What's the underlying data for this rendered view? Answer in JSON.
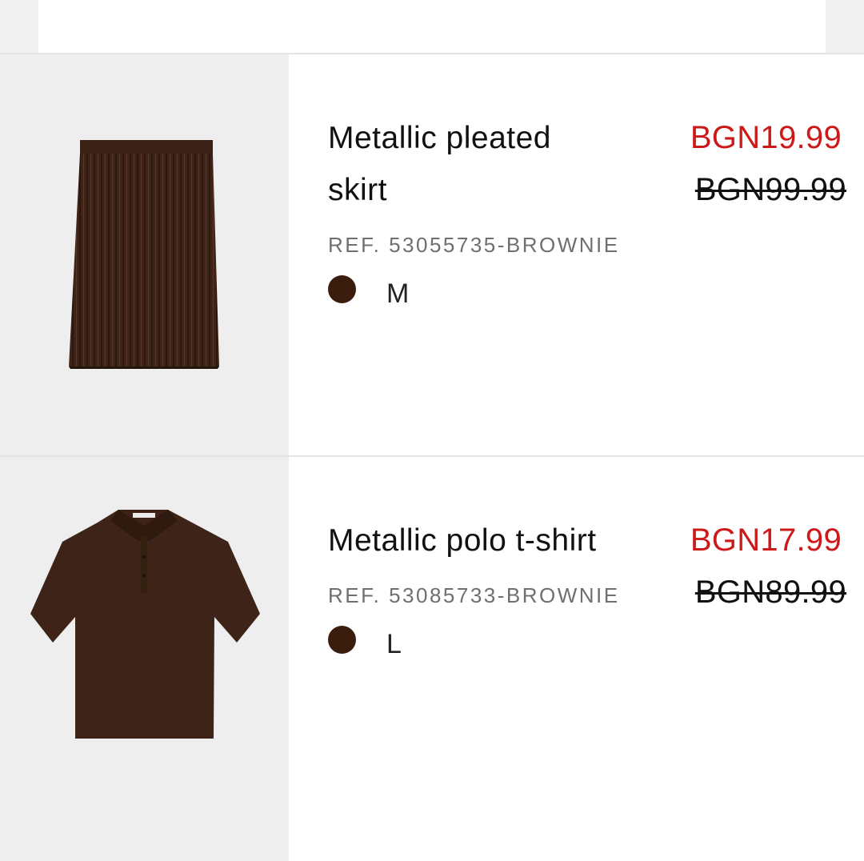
{
  "cart_items": [
    {
      "name": "Metallic pleated skirt",
      "name_line1": "Metallic pleated",
      "name_line2": "skirt",
      "sale_price": "BGN19.99",
      "original_price": "BGN99.99",
      "reference": "REF. 53055735-BROWNIE",
      "color_swatch": "#3b1d0e",
      "size": "M",
      "image_icon": "pleated-skirt-image"
    },
    {
      "name": "Metallic polo t-shirt",
      "sale_price": "BGN17.99",
      "original_price": "BGN89.99",
      "reference": "REF. 53085733-BROWNIE",
      "color_swatch": "#3b1d0e",
      "size": "L",
      "image_icon": "polo-shirt-image"
    }
  ],
  "colors": {
    "sale_price": "#cc1a1a",
    "reference_text": "#6f6f6f",
    "image_background": "#eeeeee",
    "garment": "#3e2418"
  }
}
